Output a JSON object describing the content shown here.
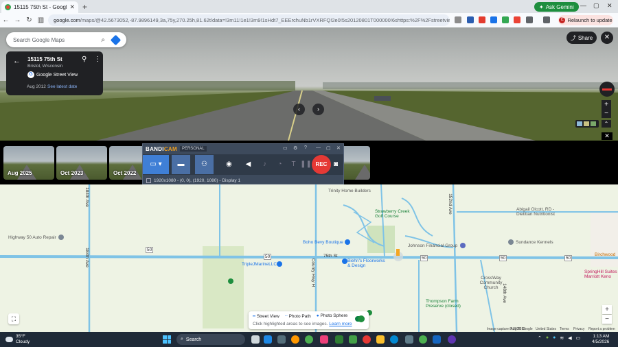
{
  "browser": {
    "tab_title": "15115 75th St - Google Maps",
    "new_tab": "+",
    "ask_gemini": "Ask Gemini",
    "url_domain": "google.com",
    "url_rest": "/maps/@42.5673052,-87.9896149,3a,75y,270.25h,81.62t/data=!3m11!1e1!3m9!1sHdt7_EEErchuNb1rVXRFQ!2e0!5s20120801T000000!6shttps:%2F%2Fstreetviewpixels-pa.googl...",
    "relaunch": "Relaunch to update",
    "profile_initial": "E"
  },
  "search": {
    "placeholder": "Search Google Maps"
  },
  "infocard": {
    "address": "15115 75th St",
    "city": "Bristol, Wisconsin",
    "provider": "Google Street View",
    "date": "Aug 2012",
    "latest_link": "See latest date"
  },
  "share_label": "Share",
  "timeline": [
    {
      "label": "Aug 2025"
    },
    {
      "label": "Oct 2023"
    },
    {
      "label": "Oct 2022"
    }
  ],
  "bandicam": {
    "brand_a": "BANDI",
    "brand_b": "CAM",
    "edition": "PERSONAL",
    "rec": "REC",
    "status": "1920x1080 - (0, 0), (1920, 1080) - Display 1"
  },
  "map": {
    "labels": {
      "trinity": "Trinity Home Builders",
      "strawberry": "Strawberry Creek Golf Course",
      "abigail": "Abigail Olcott, RD - Dietitian Nutritionist",
      "hwy50": "Highway 50 Auto Repair",
      "boho": "Boho Bevy Boutique",
      "johnson": "Johnson Financial Group",
      "sundance": "Sundance Kennels",
      "triplej": "TripleJMarineLLC",
      "biehn": "Biehn's Floorworks & Design",
      "crossway": "CrossWay Community Church",
      "springhill": "SpringHill Suites Marriott Keno",
      "thompson": "Thompson Farm Preserve (closed)",
      "birchwood": "Birchwood",
      "st75": "75th St",
      "ave184": "184th Ave",
      "ave152": "152nd Ave",
      "ave148": "148th Ave",
      "county_h": "County Hwy H"
    },
    "route_shields": [
      "50",
      "50",
      "50",
      "50",
      "50",
      "50"
    ],
    "legend": {
      "street_view": "Street View",
      "photo_path": "Photo Path",
      "photo_sphere": "Photo Sphere",
      "hint": "Click highlighted areas to see images.",
      "learn_more": "Learn more"
    },
    "attribution": {
      "capture": "Image capture: Aug 2012",
      "copyright": "© 2026 Google",
      "region": "United States",
      "terms": "Terms",
      "privacy": "Privacy",
      "report": "Report a problem"
    }
  },
  "taskbar": {
    "temp": "35°F",
    "weather": "Cloudy",
    "search": "Search",
    "time": "1:13 AM",
    "date": "4/5/2026"
  },
  "colors": {
    "accent": "#1a73e8",
    "gemini": "#1e8e3e",
    "rec": "#e53935",
    "map_road": "#7fc3e6",
    "map_bg": "#eef3e4"
  }
}
